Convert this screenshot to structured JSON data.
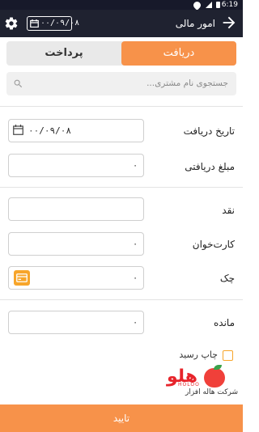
{
  "status_bar": {
    "time": "6:19"
  },
  "app_bar": {
    "title": "امور مالی",
    "date": "۰۰/۰۹/۰۸"
  },
  "tabs": {
    "receive": "دریافت",
    "pay": "پرداخت",
    "active": "receive"
  },
  "search": {
    "placeholder": "جستجوی نام مشتری..."
  },
  "form": {
    "receive_date": {
      "label": "تاریخ دریافت",
      "value": "۰۰/۰۹/۰۸"
    },
    "received_amount": {
      "label": "مبلغ دریافتی",
      "value": "۰"
    },
    "cash": {
      "label": "نقد",
      "value": ""
    },
    "card_reader": {
      "label": "کارت‌خوان",
      "value": "۰"
    },
    "cheque": {
      "label": "چک",
      "value": "۰"
    },
    "balance": {
      "label": "مانده",
      "value": "۰"
    }
  },
  "print_receipt": {
    "label": "چاپ رسید",
    "checked": false
  },
  "logo": {
    "word": "هلو",
    "latin": "HOLOO",
    "company": "شرکت هاله افزار"
  },
  "confirm_button": {
    "label": "تایید"
  },
  "colors": {
    "accent": "#f7924a",
    "app_bar": "#1f2230",
    "cheque_icon": "#f7a52a"
  }
}
